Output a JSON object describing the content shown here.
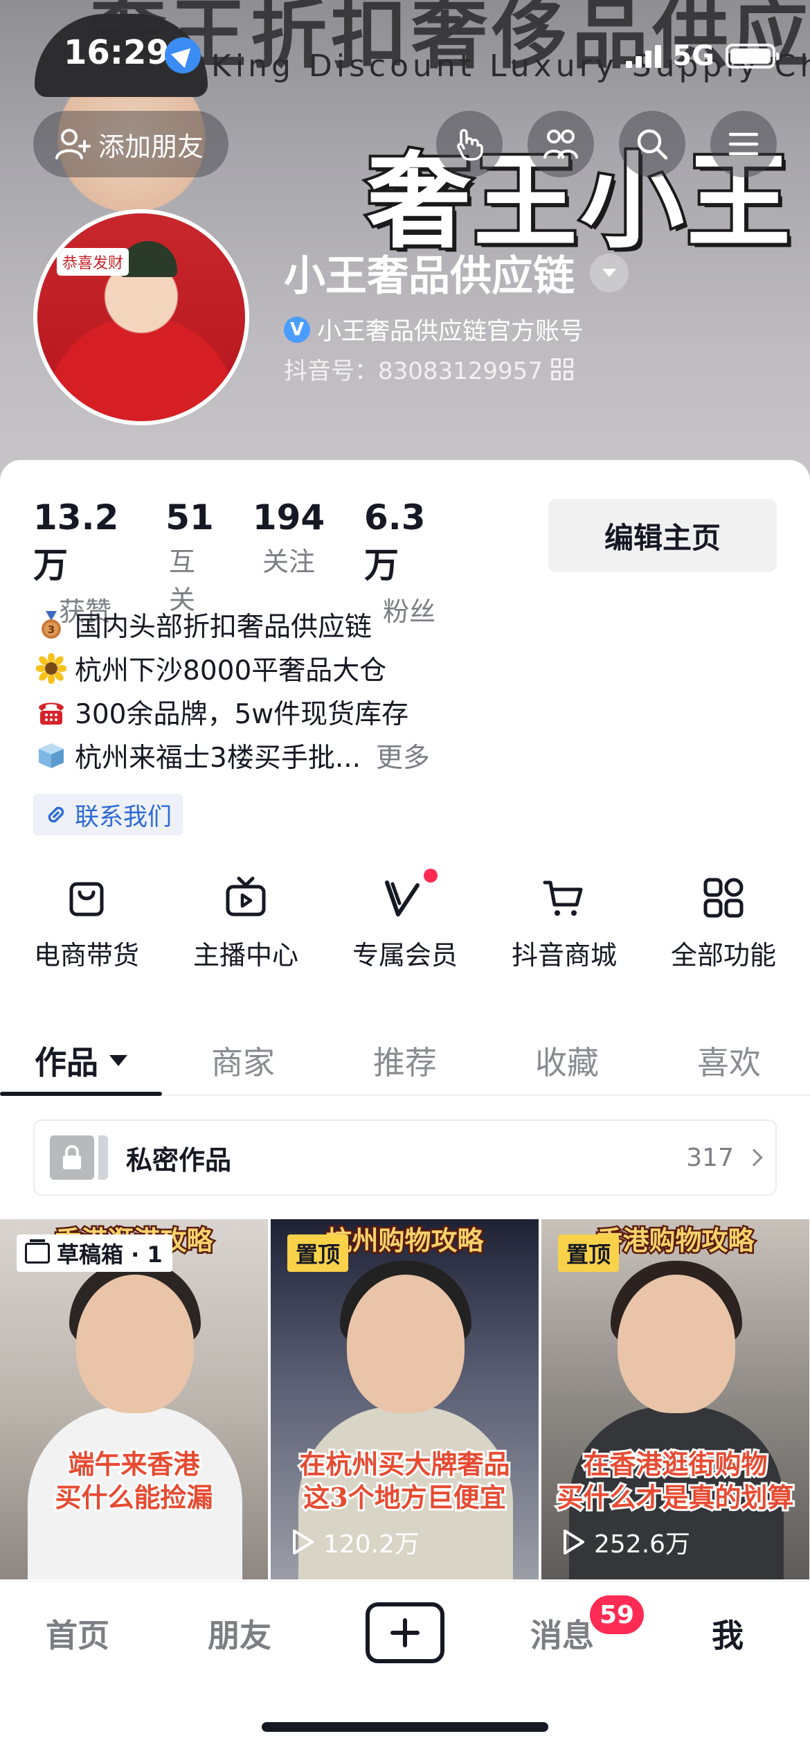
{
  "status_bar": {
    "time": "16:29",
    "network": "5G"
  },
  "banner": {
    "sign_cn": "奢王折扣奢侈品供应链",
    "sign_en": "King Discount Luxury Supply Chain",
    "brand_text": "奢王小王"
  },
  "header": {
    "add_friend_label": "添加朋友"
  },
  "avatar": {
    "tag_text": "恭喜发财"
  },
  "profile": {
    "name": "小王奢品供应链",
    "verified_text": "小王奢品供应链官方账号",
    "douyin_id": "抖音号：83083129957"
  },
  "stats": [
    {
      "value": "13.2万",
      "label": "获赞"
    },
    {
      "value": "51",
      "label": "互关"
    },
    {
      "value": "194",
      "label": "关注"
    },
    {
      "value": "6.3万",
      "label": "粉丝"
    }
  ],
  "edit_button_label": "编辑主页",
  "bio": {
    "lines": [
      {
        "emoji": "medal-icon",
        "text": "国内头部折扣奢品供应链"
      },
      {
        "emoji": "sunflower-icon",
        "text": "杭州下沙8000平奢品大仓"
      },
      {
        "emoji": "telephone-icon",
        "text": "300余品牌，5w件现货库存"
      },
      {
        "emoji": "box-icon",
        "text": "杭州来福士3楼买手批..."
      }
    ],
    "more_label": "更多"
  },
  "contact_label": "联系我们",
  "features": [
    {
      "icon": "shopping-bag-icon",
      "label": "电商带货"
    },
    {
      "icon": "tv-icon",
      "label": "主播中心"
    },
    {
      "icon": "vip-icon",
      "label": "专属会员"
    },
    {
      "icon": "cart-icon",
      "label": "抖音商城"
    },
    {
      "icon": "apps-grid-icon",
      "label": "全部功能"
    }
  ],
  "tabs": [
    {
      "label": "作品",
      "active": true
    },
    {
      "label": "商家"
    },
    {
      "label": "推荐"
    },
    {
      "label": "收藏"
    },
    {
      "label": "喜欢"
    }
  ],
  "private_works": {
    "label": "私密作品",
    "count": "317"
  },
  "videos": [
    {
      "badge": "草稿箱 · 1",
      "title": "香港逛港攻略",
      "caption_line1": "端午来香港",
      "caption_line2": "买什么能捡漏",
      "plays": ""
    },
    {
      "badge": "置顶",
      "title": "杭州购物攻略",
      "caption_line1": "在杭州买大牌奢品",
      "caption_line2": "这3个地方巨便宜",
      "plays": "120.2万"
    },
    {
      "badge": "置顶",
      "title": "香港购物攻略",
      "caption_line1": "在香港逛街购物",
      "caption_line2": "买什么才是真的划算",
      "plays": "252.6万"
    }
  ],
  "bottom_nav": {
    "home": "首页",
    "friends": "朋友",
    "messages": "消息",
    "messages_badge": "59",
    "me": "我"
  },
  "colors": {
    "accent_red": "#fe2c55",
    "pin_yellow": "#f9d24a",
    "link_blue": "#2e6bd6"
  }
}
